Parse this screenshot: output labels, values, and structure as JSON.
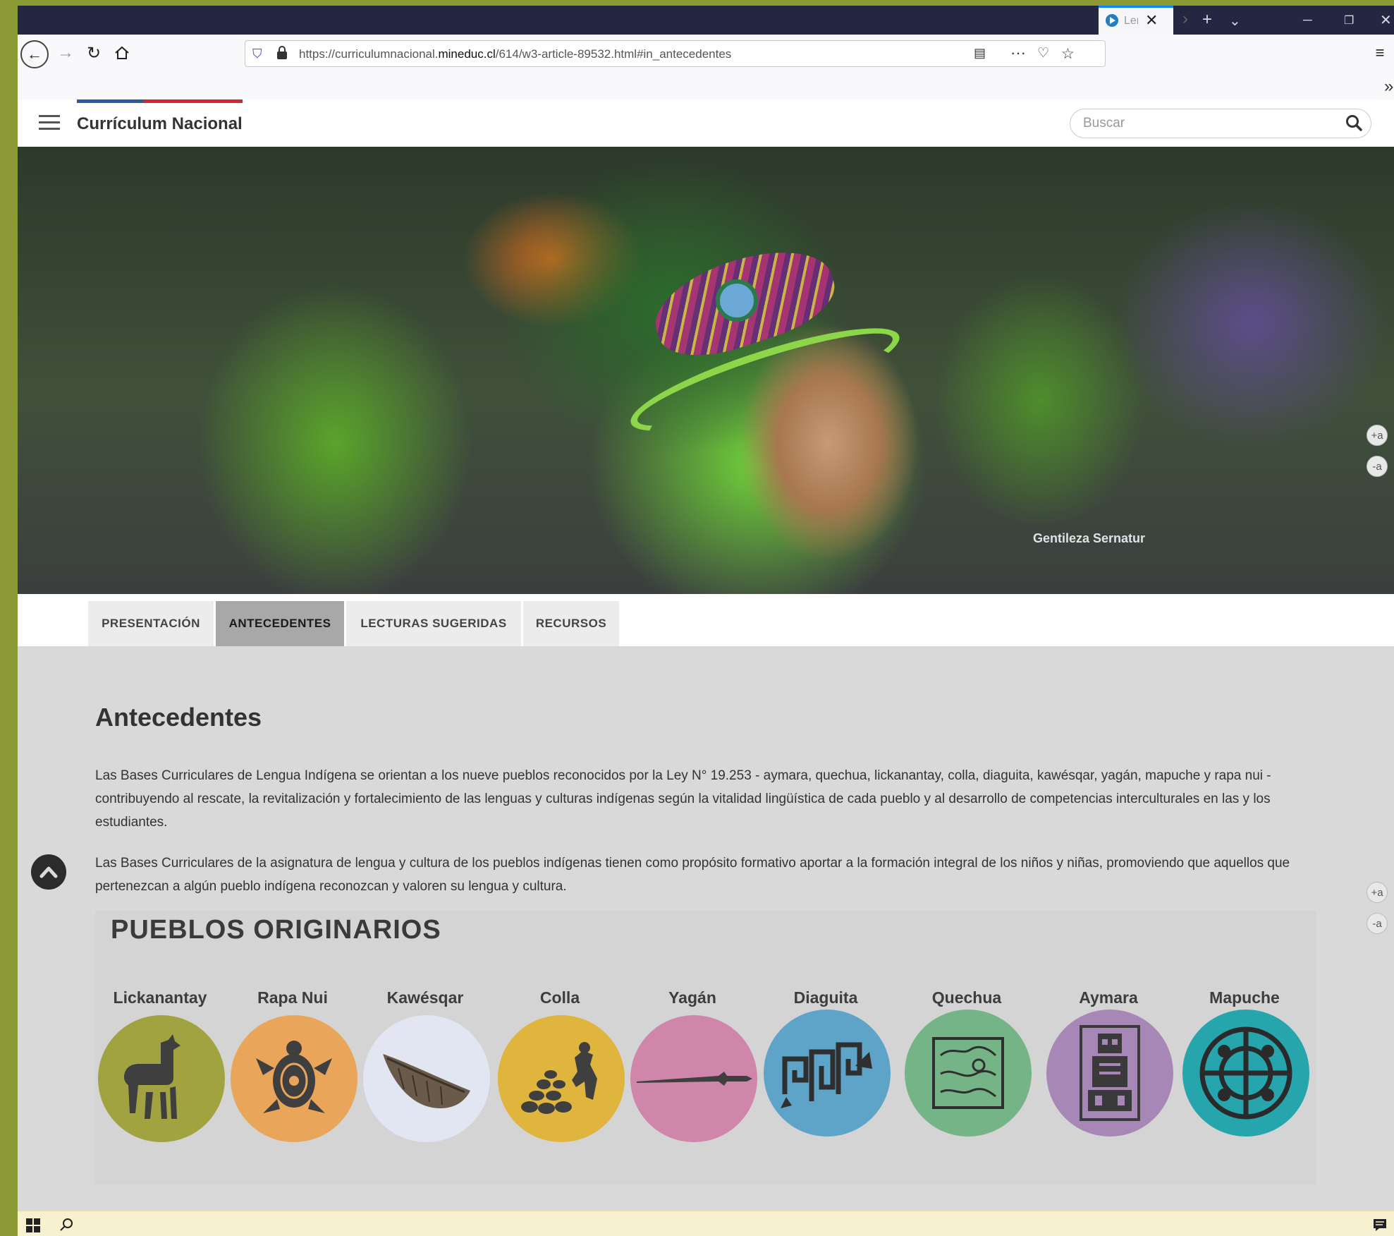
{
  "browser": {
    "tab_title": "Ler",
    "url_prefix": "https://curriculumnacional.",
    "url_domain": "mineduc.cl",
    "url_path": "/614/w3-article-89532.html#in_antecedentes"
  },
  "site": {
    "title": "Currículum Nacional",
    "search_placeholder": "Buscar"
  },
  "hero": {
    "caption": "Gentileza Sernatur",
    "font_increase": "+a",
    "font_decrease": "-a"
  },
  "tabs": [
    {
      "label": "PRESENTACIÓN"
    },
    {
      "label": "ANTECEDENTES"
    },
    {
      "label": "LECTURAS SUGERIDAS"
    },
    {
      "label": "RECURSOS"
    }
  ],
  "content": {
    "title": "Antecedentes",
    "paragraph1": "Las Bases Curriculares de Lengua Indígena se orientan a los nueve pueblos reconocidos por la Ley N° 19.253 - aymara, quechua, lickanantay, colla, diaguita, kawésqar, yagán, mapuche y rapa nui - contribuyendo al rescate, la revitalización y fortalecimiento de las lenguas y culturas indígenas según la vitalidad lingüística de cada pueblo y al desarrollo de competencias interculturales en las y los estudiantes.",
    "paragraph2": "Las Bases Curriculares de la asignatura de lengua y cultura de los pueblos indígenas tienen como propósito formativo aportar a la formación integral de los niños y niñas, promoviendo que aquellos que pertenezcan a algún pueblo indígena reconozcan y valoren su lengua y cultura."
  },
  "pueblos": {
    "title": "PUEBLOS ORIGINARIOS",
    "items": [
      {
        "name": "Lickanantay",
        "color": "#a1a240",
        "icon": "llama-icon"
      },
      {
        "name": "Rapa Nui",
        "color": "#e9a65b",
        "icon": "turtle-icon"
      },
      {
        "name": "Kawésqar",
        "color": "#e1e6f2",
        "icon": "canoe-icon"
      },
      {
        "name": "Colla",
        "color": "#e0b53e",
        "icon": "stones-icon"
      },
      {
        "name": "Yagán",
        "color": "#cf86aa",
        "icon": "harpoon-icon"
      },
      {
        "name": "Diaguita",
        "color": "#5ea4c8",
        "icon": "diaguita-pattern-icon"
      },
      {
        "name": "Quechua",
        "color": "#74b486",
        "icon": "quechua-pattern-icon"
      },
      {
        "name": "Aymara",
        "color": "#a787b5",
        "icon": "aymara-figure-icon"
      },
      {
        "name": "Mapuche",
        "color": "#27a5ad",
        "icon": "kultrun-icon"
      }
    ]
  }
}
